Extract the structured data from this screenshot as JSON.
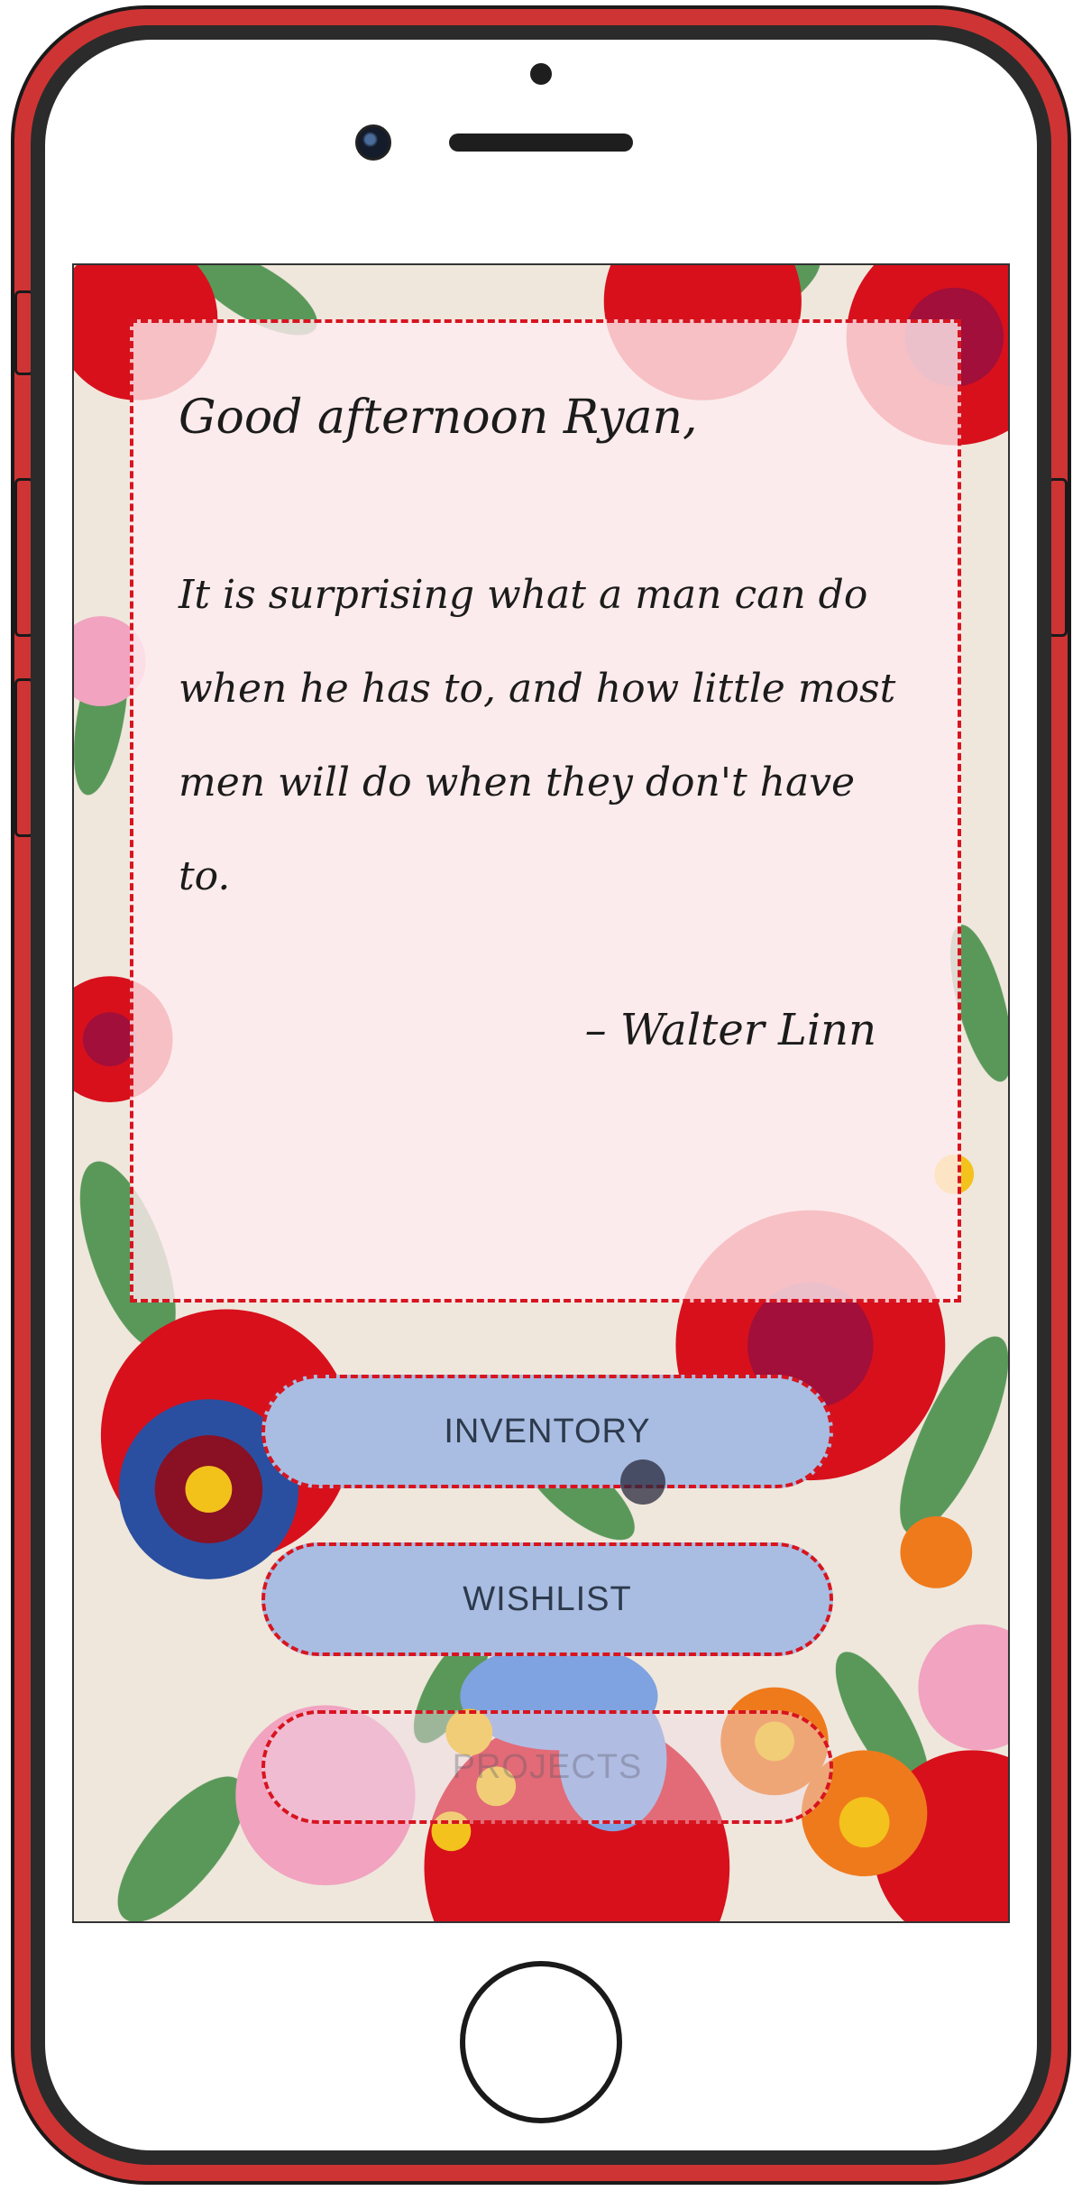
{
  "quote_card": {
    "greeting": "Good afternoon Ryan,",
    "quote": "It is surprising what a man can do when he has to, and how little most men will do when they don't have to.",
    "author": "– Walter Linn"
  },
  "menu": {
    "inventory_label": "INVENTORY",
    "wishlist_label": "WISHLIST",
    "projects_label": "PROJECTS"
  },
  "colors": {
    "frame": "#cf3434",
    "dashed_border": "#d7141f",
    "button_fill": "#a9bde2",
    "card_fill": "#ffecf0"
  },
  "icons": {
    "front_camera": "camera-icon",
    "home_button": "home-button-icon"
  }
}
